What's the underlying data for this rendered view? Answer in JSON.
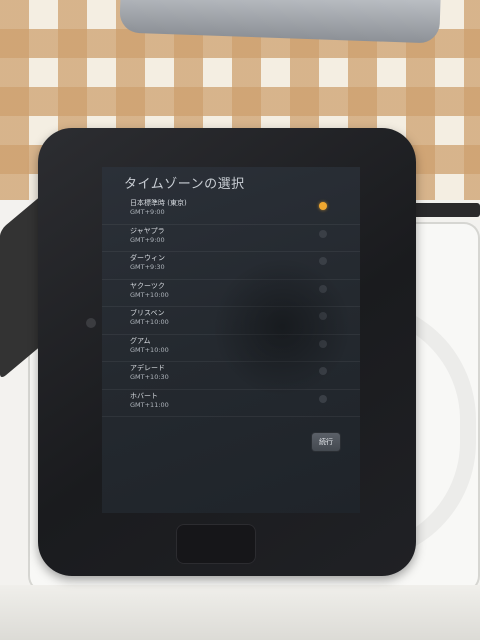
{
  "screen": {
    "title": "タイムゾーンの選択",
    "timezones": [
      {
        "name": "日本標準時 (東京)",
        "offset": "GMT+9:00",
        "selected": true
      },
      {
        "name": "ジャヤプラ",
        "offset": "GMT+9:00",
        "selected": false
      },
      {
        "name": "ダーウィン",
        "offset": "GMT+9:30",
        "selected": false
      },
      {
        "name": "ヤクーツク",
        "offset": "GMT+10:00",
        "selected": false
      },
      {
        "name": "ブリスベン",
        "offset": "GMT+10:00",
        "selected": false
      },
      {
        "name": "グアム",
        "offset": "GMT+10:00",
        "selected": false
      },
      {
        "name": "アデレード",
        "offset": "GMT+10:30",
        "selected": false
      },
      {
        "name": "ホバート",
        "offset": "GMT+11:00",
        "selected": false
      }
    ],
    "continue_label": "続行"
  },
  "colors": {
    "accent": "#f0a830",
    "screen_bg": "#262b31"
  }
}
